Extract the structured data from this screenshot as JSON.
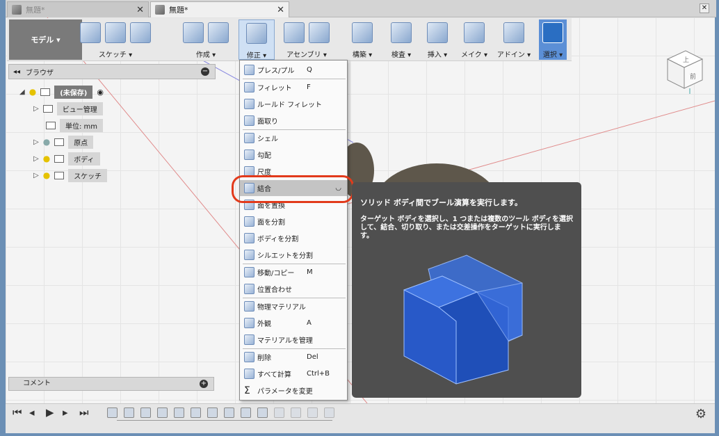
{
  "tabs": [
    {
      "label": "無題*",
      "active": false
    },
    {
      "label": "無題*",
      "active": true
    }
  ],
  "toolbar": {
    "workspace": "モデル ▾",
    "groups": [
      {
        "label": "スケッチ ▾"
      },
      {
        "label": "作成 ▾"
      },
      {
        "label": "修正 ▾"
      },
      {
        "label": "アセンブリ ▾"
      },
      {
        "label": "構築 ▾"
      },
      {
        "label": "検査 ▾"
      },
      {
        "label": "挿入 ▾"
      },
      {
        "label": "メイク ▾"
      },
      {
        "label": "アドイン ▾"
      },
      {
        "label": "選択 ▾"
      }
    ]
  },
  "browser": {
    "title": "ブラウザ",
    "root": "(未保存)",
    "items": [
      {
        "label": "ビュー管理"
      },
      {
        "label": "単位: mm"
      },
      {
        "label": "原点"
      },
      {
        "label": "ボディ"
      },
      {
        "label": "スケッチ"
      }
    ]
  },
  "comment": {
    "label": "コメント"
  },
  "menu": {
    "items": [
      {
        "label": "プレス/プル",
        "shortcut": "Q"
      },
      {
        "label": "フィレット",
        "shortcut": "F"
      },
      {
        "label": "ルールド フィレット",
        "shortcut": ""
      },
      {
        "label": "面取り",
        "shortcut": ""
      },
      {
        "label": "シェル",
        "shortcut": ""
      },
      {
        "label": "勾配",
        "shortcut": ""
      },
      {
        "label": "尺度",
        "shortcut": ""
      },
      {
        "label": "結合",
        "shortcut": ""
      },
      {
        "label": "面を置換",
        "shortcut": ""
      },
      {
        "label": "面を分割",
        "shortcut": ""
      },
      {
        "label": "ボディを分割",
        "shortcut": ""
      },
      {
        "label": "シルエットを分割",
        "shortcut": ""
      },
      {
        "label": "移動/コピー",
        "shortcut": "M"
      },
      {
        "label": "位置合わせ",
        "shortcut": ""
      },
      {
        "label": "物理マテリアル",
        "shortcut": ""
      },
      {
        "label": "外観",
        "shortcut": "A"
      },
      {
        "label": "マテリアルを管理",
        "shortcut": ""
      },
      {
        "label": "削除",
        "shortcut": "Del"
      },
      {
        "label": "すべて計算",
        "shortcut": "Ctrl+B"
      },
      {
        "label": "パラメータを変更",
        "shortcut": ""
      }
    ]
  },
  "tooltip": {
    "title": "ソリッド ボディ間でブール演算を実行します。",
    "description": "ターゲット ボディを選択し、1 つまたは複数のツール ボディを選択して、結合、切り取り、または交差操作をターゲットに実行します。"
  },
  "viewcube": {
    "top": "上",
    "front": "前"
  },
  "colors": {
    "accent": "#5b8fd6",
    "highlight": "#e23a1b",
    "tooltip_bg": "#4f4f4f"
  }
}
